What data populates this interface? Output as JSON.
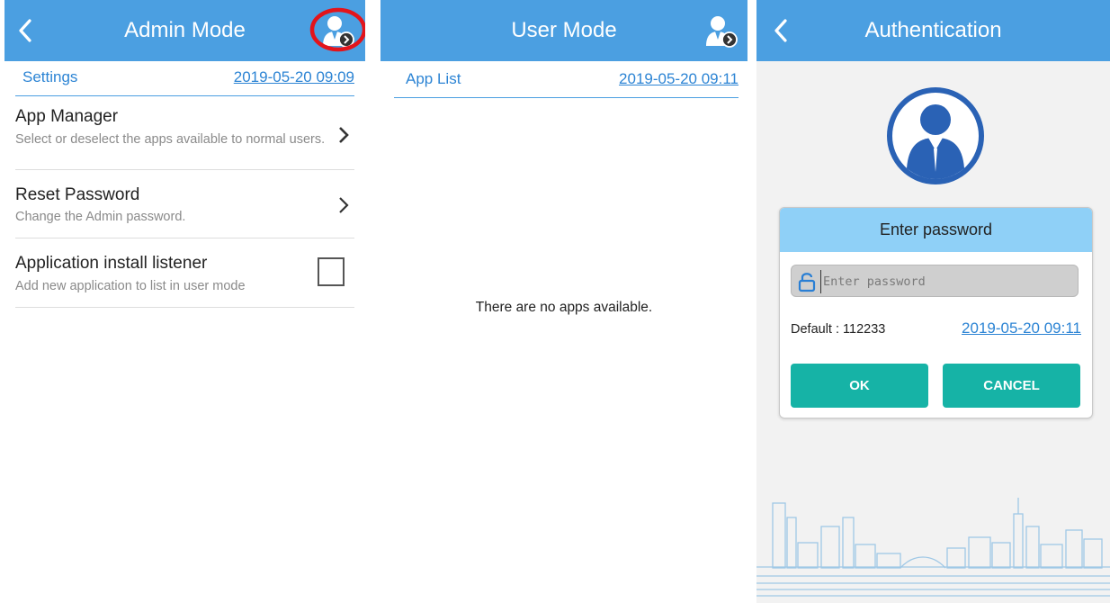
{
  "admin": {
    "title": "Admin Mode",
    "section": "Settings",
    "datetime": "2019-05-20 09:09",
    "items": [
      {
        "title": "App Manager",
        "desc": "Select or deselect the apps available to normal users."
      },
      {
        "title": "Reset Password",
        "desc": "Change the Admin password."
      },
      {
        "title": "Application install listener",
        "desc": "Add new application to list in user mode"
      }
    ]
  },
  "user": {
    "title": "User Mode",
    "section": "App List",
    "datetime": "2019-05-20 09:11",
    "empty_message": "There are no apps available."
  },
  "auth": {
    "title": "Authentication",
    "dialog": {
      "title": "Enter password",
      "placeholder": "Enter password",
      "default_text": "Default : 112233",
      "datetime": "2019-05-20 09:11",
      "ok_label": "OK",
      "cancel_label": "CANCEL"
    }
  },
  "colors": {
    "appbar": "#4b9fe1",
    "accent_text": "#2c84d4",
    "dialog_header": "#8fd0f7",
    "button": "#16b3a6",
    "highlight_ring": "#e3141b"
  },
  "icons": [
    "back-icon",
    "user-switch-icon",
    "chevron-right-icon",
    "lock-icon",
    "user-avatar-icon",
    "city-skyline-illustration"
  ]
}
